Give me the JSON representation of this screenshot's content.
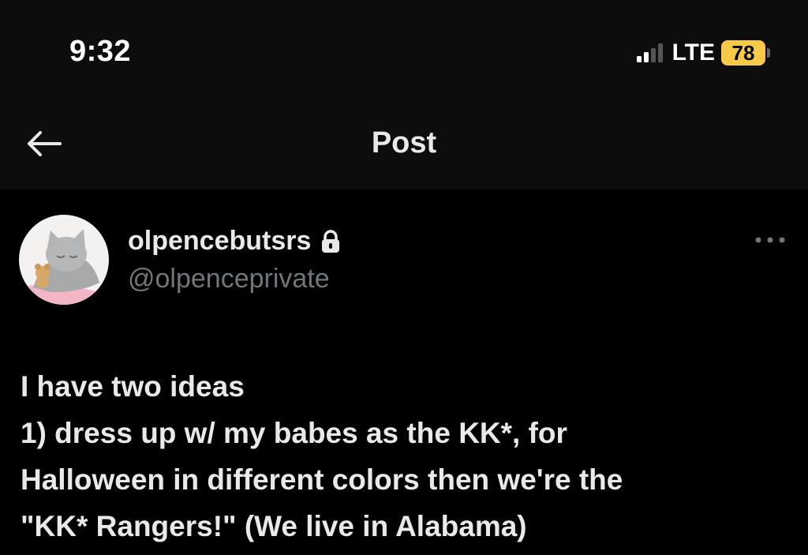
{
  "status_bar": {
    "time": "9:32",
    "network": "LTE",
    "battery_percent": "78",
    "signal_bars_active": 2,
    "signal_bars_total": 4
  },
  "header": {
    "title": "Post",
    "back_icon": "arrow-left-icon"
  },
  "post": {
    "author": {
      "display_name": "olpencebutsrs",
      "handle": "@olpenceprivate",
      "protected_icon": "lock-icon",
      "avatar_icon": "sleeping-cat-avatar"
    },
    "more_icon": "more-horizontal-icon",
    "lines": [
      "I have two ideas",
      "1) dress up w/ my babes as the KK*, for",
      "Halloween in different colors then we're the",
      "\"KK* Rangers!\" (We live in Alabama)"
    ]
  },
  "colors": {
    "background": "#000000",
    "header_bg": "#0d0d0d",
    "text_primary": "#e7e9ea",
    "text_secondary": "#71767b",
    "battery": "#f7c948"
  }
}
